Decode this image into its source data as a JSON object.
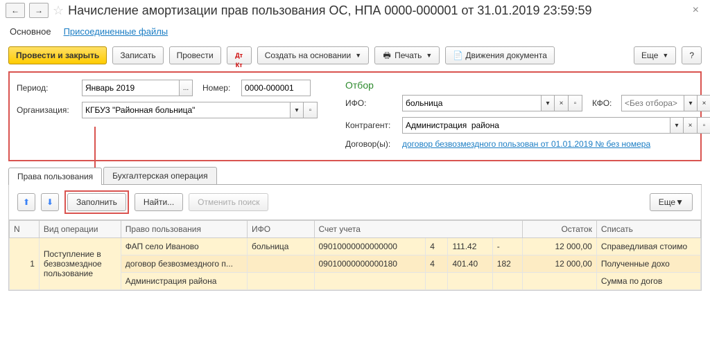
{
  "header": {
    "title": "Начисление амортизации прав пользования ОС, НПА 0000-000001 от 31.01.2019 23:59:59",
    "back": "←",
    "forward": "→"
  },
  "nav": {
    "main": "Основное",
    "files": "Присоединенные файлы"
  },
  "toolbar": {
    "post_close": "Провести и закрыть",
    "save": "Записать",
    "post": "Провести",
    "dtkt": "Дт/Кт",
    "create_based": "Создать на основании",
    "print": "Печать",
    "movements": "Движения документа",
    "more": "Еще",
    "help": "?"
  },
  "form": {
    "period_label": "Период:",
    "period_value": "Январь 2019",
    "number_label": "Номер:",
    "number_value": "0000-000001",
    "org_label": "Организация:",
    "org_value": "КГБУЗ \"Районная больница\"",
    "otbor": "Отбор",
    "ifo_label": "ИФО:",
    "ifo_value": "больница",
    "kfo_label": "КФО:",
    "kfo_placeholder": "<Без отбора>",
    "counter_label": "Контрагент:",
    "counter_value": "Администрация  района",
    "contracts_label": "Договор(ы):",
    "contracts_link": "договор безвозмездного пользован от 01.01.2019 № без номера"
  },
  "tabs": {
    "t1": "Права пользования",
    "t2": "Бухгалтерская операция"
  },
  "tableToolbar": {
    "fill": "Заполнить",
    "find": "Найти...",
    "cancel": "Отменить поиск",
    "more": "Еще"
  },
  "columns": {
    "n": "N",
    "op": "Вид операции",
    "right": "Право пользования",
    "ifo": "ИФО",
    "acc": "Счет учета",
    "ost": "Остаток",
    "sp": "Списать"
  },
  "rows": {
    "r1": {
      "n": "1",
      "op": "Поступление в безвозмездное пользование",
      "right": "ФАП село Иваново",
      "ifo": "больница",
      "acc": "09010000000000000",
      "s1": "4",
      "s2": "111.42",
      "s3": "-",
      "ost": "12 000,00",
      "sp": "Справедливая стоимо"
    },
    "r2": {
      "right": "договор безвозмездного п...",
      "acc": "09010000000000180",
      "s1": "4",
      "s2": "401.40",
      "s3": "182",
      "ost": "12 000,00",
      "sp": "Полученные дохо"
    },
    "r3": {
      "right": "Администрация  района",
      "sp": "Сумма по догов"
    }
  }
}
